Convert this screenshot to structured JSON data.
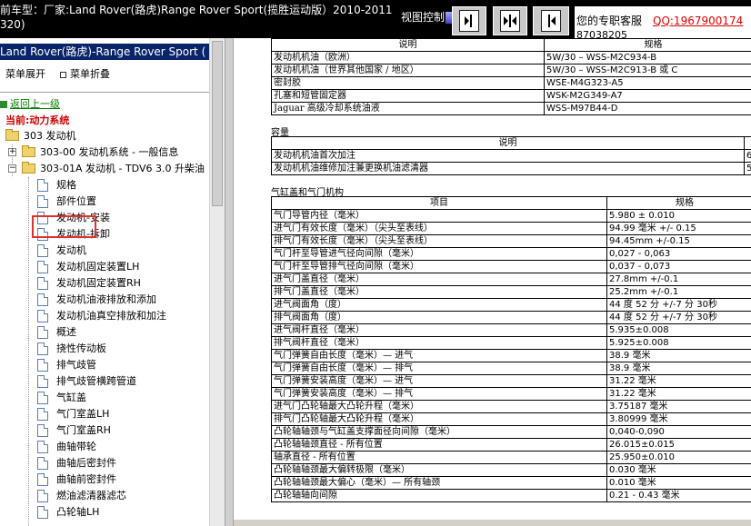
{
  "header": {
    "car_title": "前车型：厂家:Land Rover(路虎)Range Rover Sport(揽胜运动版）2010-2011 320)",
    "view_label": "视图控制",
    "view_buttons": [
      "left-only",
      "both",
      "right-only"
    ],
    "support_label": "您的专职客服",
    "support_qq": "QQ:1967900174",
    "support_phone": "87038205"
  },
  "left": {
    "title": "Land Rover(路虎)-Range Rover Sport ( 揽胜运",
    "expand_all": "菜单展开",
    "collapse_all": "菜单折叠",
    "back": "返回上一级",
    "current": "当前:动力系统",
    "tree": {
      "root": {
        "label": "303 发动机",
        "expanded": true
      },
      "children": [
        {
          "label": "303-00 发动机系统 - 一般信息",
          "expanded": false
        },
        {
          "label": "303-01A 发动机 - TDV6 3.0 升柴油",
          "expanded": true
        }
      ],
      "leaves": [
        "规格",
        "部件位置",
        "发动机-安装",
        "发动机-拆卸",
        "发动机",
        "发动机固定装置LH",
        "发动机固定装置RH",
        "发动机油液排放和添加",
        "发动机油真空排放和加注",
        "概述",
        "挠性传动板",
        "排气歧管",
        "排气歧管横跨管道",
        "气缸盖",
        "气门室盖LH",
        "气门室盖RH",
        "曲轴带轮",
        "曲轴后密封件",
        "曲轴前密封件",
        "燃油滤清器滤芯",
        "凸轮轴LH"
      ],
      "selected": "规格"
    }
  },
  "right": {
    "lubricants": {
      "headers": [
        "说明",
        "规格"
      ],
      "rows": [
        [
          "发动机机油（欧洲）",
          "5W/30 – WSS-M2C934-B"
        ],
        [
          "发动机机油（世界其他国家 / 地区）",
          "5W/30 – WSS-M2C913-B 或 C"
        ],
        [
          "密封胶",
          "WSE-M4G323-A5"
        ],
        [
          "孔塞和短管固定器",
          "WSK-M2G349-A7"
        ],
        [
          "Jaguar 高级冷却系统油液",
          "WSS-M97B44-D"
        ]
      ]
    },
    "capacity": {
      "title": "容量",
      "headers": [
        "说明",
        ""
      ],
      "rows": [
        [
          "发动机机油首次加注",
          "6"
        ],
        [
          "发动机机油维修加注兼更换机油滤清器",
          "5"
        ]
      ]
    },
    "cylinder_head": {
      "title": "气缸盖和气门机构",
      "headers": [
        "项目",
        "规格"
      ],
      "rows": [
        [
          "气门导管内径（毫米）",
          "5.980 ± 0.010"
        ],
        [
          "进气门有效长度（毫米）（尖头至表线）",
          "94.99 毫米 +/- 0.15"
        ],
        [
          "排气门有效长度（毫米）（尖头至表线）",
          "94.45mm +/-0.15"
        ],
        [
          "气门杆至导管进气径向间隙（毫米）",
          "0,027 - 0,063"
        ],
        [
          "气门杆至导管排气径向间隙（毫米）",
          "0,037 - 0,073"
        ],
        [
          "进气门盖直径（毫米）",
          "27.8mm +/-0.1"
        ],
        [
          "排气门盖直径（毫米）",
          "25.2mm +/-0.1"
        ],
        [
          "进气阀面角（度）",
          "44 度 52 分 +/-7 分 30秒"
        ],
        [
          "排气阀面角（度）",
          "44 度 52 分 +/-7 分 30秒"
        ],
        [
          "进气阀杆直径（毫米）",
          "5.935±0.008"
        ],
        [
          "排气阀杆直径（毫米）",
          "5.925±0.008"
        ],
        [
          "气门弹簧自由长度（毫米）— 进气",
          "38.9 毫米"
        ],
        [
          "气门弹簧自由长度（毫米）— 排气",
          "38.9 毫米"
        ],
        [
          "气门弹簧安装高度（毫米）— 进气",
          "31.22 毫米"
        ],
        [
          "气门弹簧安装高度（毫米）— 排气",
          "31.22 毫米"
        ],
        [
          "进气门凸轮轴最大凸轮升程（毫米）",
          "3.75187 毫米"
        ],
        [
          "排气门凸轮轴最大凸轮升程（毫米）",
          "3.80999 毫米"
        ],
        [
          "凸轮轴轴颈与气缸盖支撑面径向间隙（毫米）",
          "0,040-0,090"
        ],
        [
          "凸轮轴轴颈直径 - 所有位置",
          "26.015±0.015"
        ],
        [
          "轴承直径 - 所有位置",
          "25.950±0.010"
        ],
        [
          "凸轮轴轴颈最大偏转极限（毫米）",
          "0.030 毫米"
        ],
        [
          "凸轮轴轴颈最大偏心（毫米）— 所有轴颈",
          "0.010 毫米"
        ],
        [
          "凸轮轴轴向间隙",
          "0.21 - 0.43 毫米"
        ]
      ]
    }
  },
  "colors": {
    "header_bg": "#000000",
    "left_title_bg": "#0a246a",
    "back_link": "#008000",
    "current_text": "#cc0000",
    "qq_text": "#e00000",
    "selection_box": "#e03030"
  },
  "icons": [
    "folder-icon",
    "document-icon",
    "expand-plus-icon",
    "collapse-minus-icon",
    "back-icon",
    "left-panel-icon",
    "split-panel-icon",
    "right-panel-icon"
  ]
}
